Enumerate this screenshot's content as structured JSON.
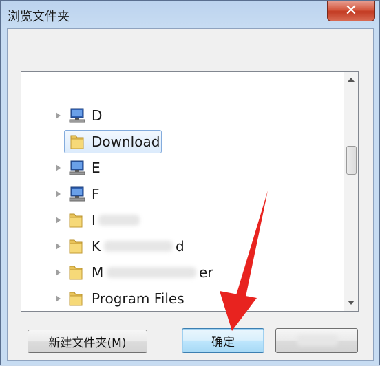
{
  "window": {
    "title": "浏览文件夹",
    "close_glyph": "✕"
  },
  "tree": {
    "items": [
      {
        "label": "D",
        "icon": "computer-drive-icon"
      },
      {
        "label": "Download",
        "icon": "folder-icon",
        "selected": true
      },
      {
        "label": "E",
        "icon": "computer-drive-icon"
      },
      {
        "label": "F",
        "icon": "computer-drive-icon"
      },
      {
        "label": "I",
        "icon": "folder-icon"
      },
      {
        "label": "K",
        "label_tail": "d",
        "icon": "folder-icon"
      },
      {
        "label": "M",
        "label_tail": "er",
        "icon": "folder-icon"
      },
      {
        "label": "Program Files",
        "icon": "folder-icon"
      }
    ]
  },
  "buttons": {
    "new_folder": "新建文件夹(M)",
    "ok": "确定",
    "cancel": ""
  },
  "colors": {
    "annotation_arrow": "#e8231f",
    "selection_border": "#84acdd"
  }
}
